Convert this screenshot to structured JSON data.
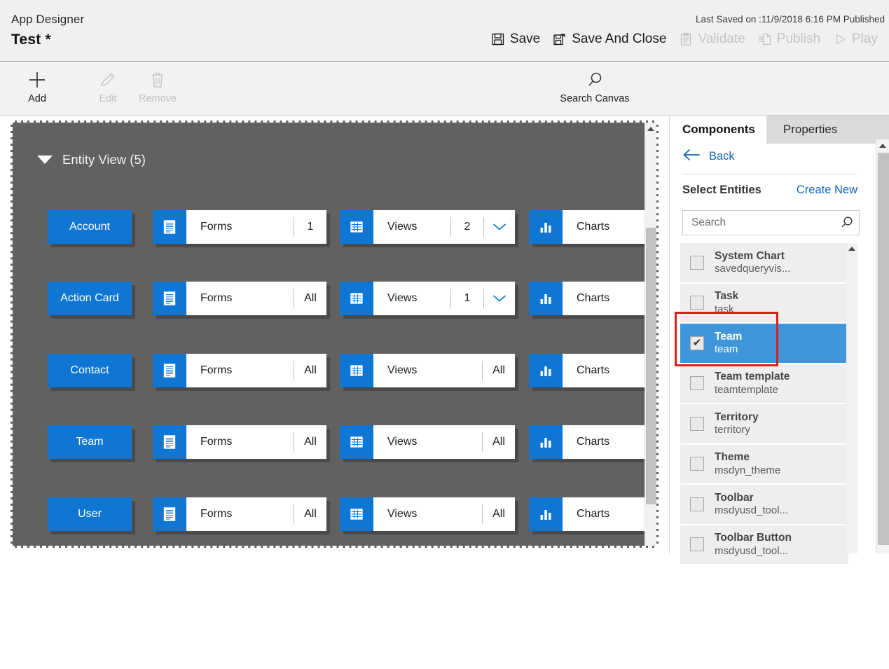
{
  "header": {
    "app_label": "App Designer",
    "app_title": "Test *",
    "last_saved": "Last Saved on :11/9/2018 6:16 PM Published",
    "actions": [
      {
        "label": "Save",
        "icon": "save-icon",
        "disabled": false
      },
      {
        "label": "Save And Close",
        "icon": "save-and-close-icon",
        "disabled": false
      },
      {
        "label": "Validate",
        "icon": "validate-icon",
        "disabled": true
      },
      {
        "label": "Publish",
        "icon": "publish-icon",
        "disabled": true
      },
      {
        "label": "Play",
        "icon": "play-icon",
        "disabled": true
      }
    ]
  },
  "commandbar": {
    "add": {
      "label": "Add",
      "icon": "plus-icon",
      "disabled": false
    },
    "edit": {
      "label": "Edit",
      "icon": "pencil-icon",
      "disabled": true
    },
    "remove": {
      "label": "Remove",
      "icon": "trash-icon",
      "disabled": true
    },
    "search_canvas": {
      "label": "Search Canvas",
      "icon": "search-icon",
      "disabled": false
    }
  },
  "canvas": {
    "section_title": "Entity View (5)",
    "tile_labels": {
      "forms": "Forms",
      "views": "Views",
      "charts": "Charts"
    },
    "rows": [
      {
        "entity": "Account",
        "forms": "1",
        "forms_chevron": false,
        "views": "2",
        "views_chevron": true,
        "charts": ""
      },
      {
        "entity": "Action Card",
        "forms": "All",
        "forms_chevron": false,
        "views": "1",
        "views_chevron": true,
        "charts": ""
      },
      {
        "entity": "Contact",
        "forms": "All",
        "forms_chevron": false,
        "views": "All",
        "views_chevron": false,
        "charts": ""
      },
      {
        "entity": "Team",
        "forms": "All",
        "forms_chevron": false,
        "views": "All",
        "views_chevron": false,
        "charts": ""
      },
      {
        "entity": "User",
        "forms": "All",
        "forms_chevron": false,
        "views": "All",
        "views_chevron": false,
        "charts": ""
      }
    ]
  },
  "panel": {
    "tabs": [
      {
        "label": "Components",
        "active": true
      },
      {
        "label": "Properties",
        "active": false
      }
    ],
    "back_label": "Back",
    "select_entities_label": "Select Entities",
    "create_new_label": "Create New",
    "search_placeholder": "Search",
    "search_value": "",
    "entities": [
      {
        "name": "System Chart",
        "logical": "savedqueryvis...",
        "checked": false,
        "selected": false
      },
      {
        "name": "Task",
        "logical": "task",
        "checked": false,
        "selected": false
      },
      {
        "name": "Team",
        "logical": "team",
        "checked": true,
        "selected": true
      },
      {
        "name": "Team template",
        "logical": "teamtemplate",
        "checked": false,
        "selected": false
      },
      {
        "name": "Territory",
        "logical": "territory",
        "checked": false,
        "selected": false
      },
      {
        "name": "Theme",
        "logical": "msdyn_theme",
        "checked": false,
        "selected": false
      },
      {
        "name": "Toolbar",
        "logical": "msdyusd_tool...",
        "checked": false,
        "selected": false
      },
      {
        "name": "Toolbar Button",
        "logical": "msdyusd_tool...",
        "checked": false,
        "selected": false
      }
    ],
    "checkbox_tick": "✔"
  },
  "colors": {
    "accent_blue": "#0f76d4",
    "link_blue": "#1466b8",
    "selected_row": "#3f96db",
    "canvas_bg": "#616161",
    "annotation_red": "#e01b1b"
  }
}
